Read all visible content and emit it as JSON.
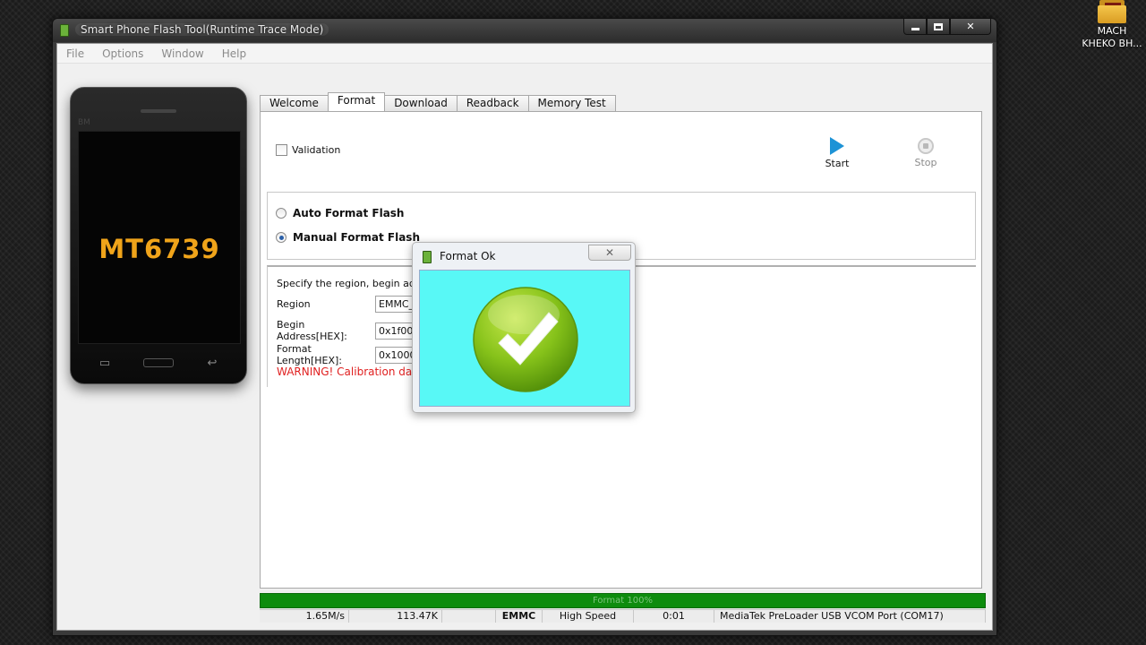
{
  "desktop": {
    "icon_label_line1": "MACH",
    "icon_label_line2": "KHEKO BH..."
  },
  "window": {
    "title": "Smart Phone Flash Tool(Runtime Trace Mode)",
    "close_glyph": "✕"
  },
  "menu": {
    "file": "File",
    "options": "Options",
    "window": "Window",
    "help": "Help"
  },
  "phone": {
    "brand": "BM",
    "chip": "MT6739",
    "menu_key": "▭",
    "back_key": "↩"
  },
  "tabs": [
    {
      "label": "Welcome"
    },
    {
      "label": "Format",
      "active": true
    },
    {
      "label": "Download"
    },
    {
      "label": "Readback"
    },
    {
      "label": "Memory Test"
    }
  ],
  "format": {
    "validation_label": "Validation",
    "validation_checked": false,
    "start_label": "Start",
    "stop_label": "Stop",
    "auto_label": "Auto Format Flash",
    "manual_label": "Manual Format Flash",
    "selected_mode": "manual",
    "region_desc": "Specify the region, begin addres",
    "region_label": "Region",
    "region_value": "EMMC_U",
    "begin_label": "Begin Address[HEX]:",
    "begin_value": "0x1f000",
    "length_label": "Format Length[HEX]:",
    "length_value": "0x10000",
    "warning": "WARNING! Calibration data"
  },
  "progress": {
    "label": "Format 100%",
    "percent": 100,
    "color": "#0e8c0e"
  },
  "status": {
    "speed": "1.65M/s",
    "size": "113.47K",
    "storage": "EMMC",
    "usb": "High Speed",
    "time": "0:01",
    "port": "MediaTek PreLoader USB VCOM Port (COM17)"
  },
  "dialog": {
    "title": "Format Ok",
    "close_glyph": "✕",
    "icon": "check-circle-icon",
    "body_color": "#58f8f6"
  }
}
